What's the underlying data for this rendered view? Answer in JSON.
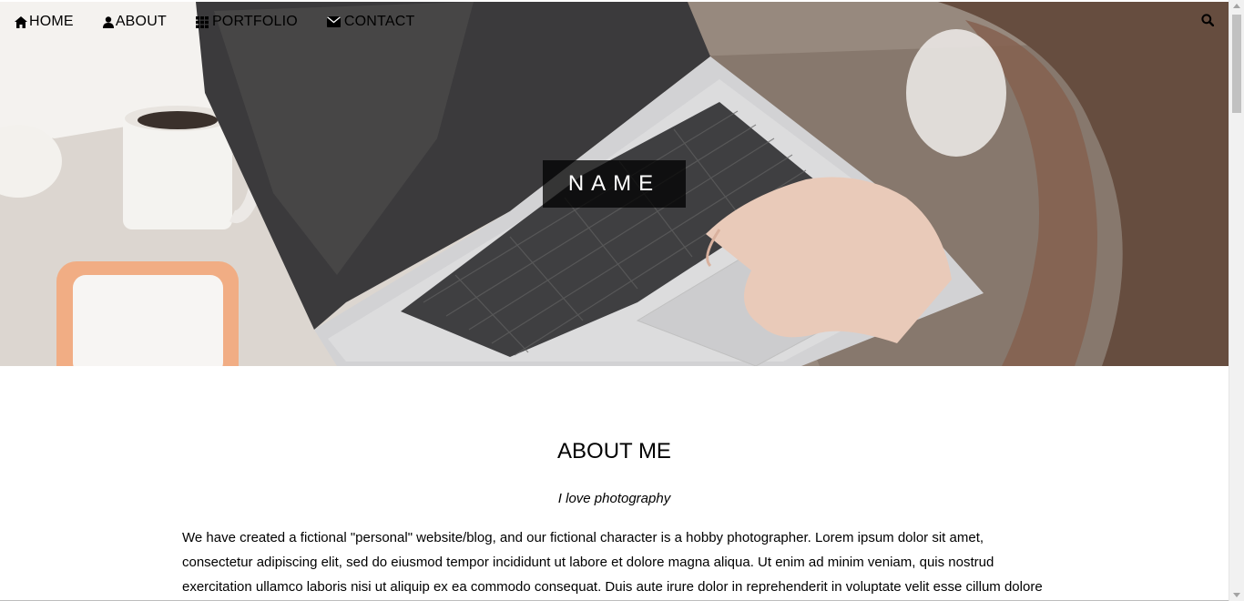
{
  "nav": {
    "items": [
      {
        "label": "HOME",
        "icon": "home-icon"
      },
      {
        "label": "ABOUT",
        "icon": "user-icon"
      },
      {
        "label": "PORTFOLIO",
        "icon": "grid-icon"
      },
      {
        "label": "CONTACT",
        "icon": "envelope-icon"
      }
    ],
    "search_icon": "search-icon"
  },
  "hero": {
    "name_label": "NAME"
  },
  "about": {
    "heading": "ABOUT ME",
    "subtitle": "I love photography",
    "paragraph": "We have created a fictional \"personal\" website/blog, and our fictional character is a hobby photographer. Lorem ipsum dolor sit amet, consectetur adipiscing elit, sed do eiusmod tempor incididunt ut labore et dolore magna aliqua. Ut enim ad minim veniam, quis nostrud exercitation ullamco laboris nisi ut aliquip ex ea commodo consequat. Duis aute irure dolor in reprehenderit in voluptate velit esse cillum dolore"
  },
  "colors": {
    "name_box_bg": "#3c3c3c",
    "text": "#000000",
    "page_bg": "#ffffff"
  }
}
